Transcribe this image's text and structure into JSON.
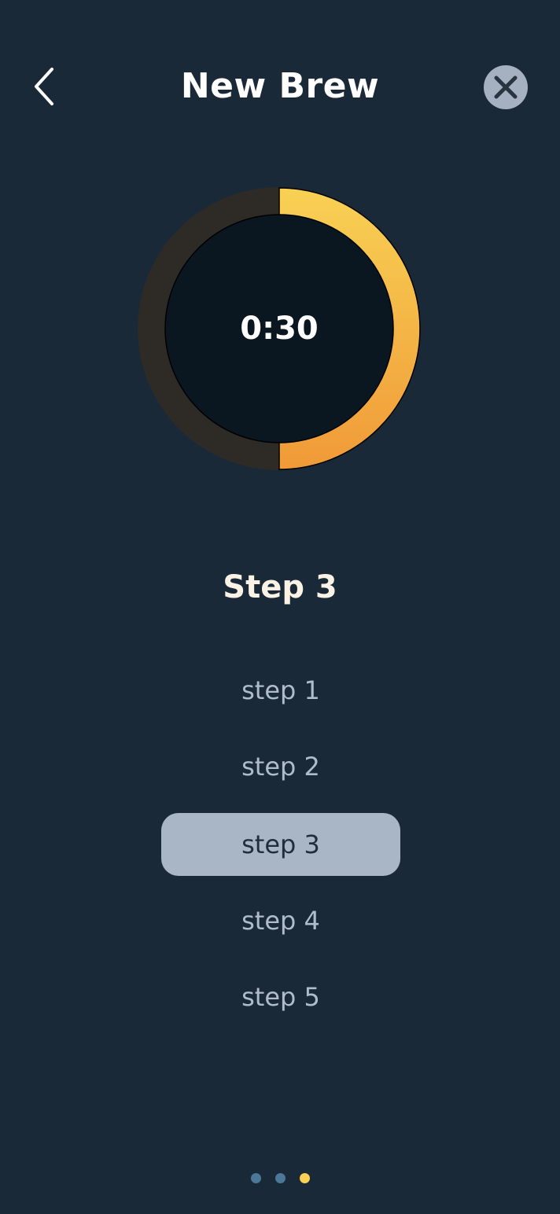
{
  "header": {
    "title": "New Brew",
    "back_icon": "chevron-left-icon",
    "close_icon": "close-circle-icon"
  },
  "timer": {
    "readout": "0:30",
    "progress": 0.5,
    "track_color": "#2e2b27",
    "inner_color": "#0a1620",
    "gradient_start": "#f8d154",
    "gradient_end": "#f09a38"
  },
  "current_step": {
    "label": "Step 3"
  },
  "steps": [
    {
      "label": "step 1",
      "active": false
    },
    {
      "label": "step 2",
      "active": false
    },
    {
      "label": "step 3",
      "active": true
    },
    {
      "label": "step 4",
      "active": false
    },
    {
      "label": "step 5",
      "active": false
    }
  ],
  "pagination": {
    "count": 3,
    "active_index": 2,
    "inactive_color": "#4a7896",
    "active_color": "#f8d154"
  },
  "colors": {
    "background": "#1a2938",
    "active_step_bg": "#a9b6c6",
    "close_button_bg": "#a5b1c0"
  }
}
